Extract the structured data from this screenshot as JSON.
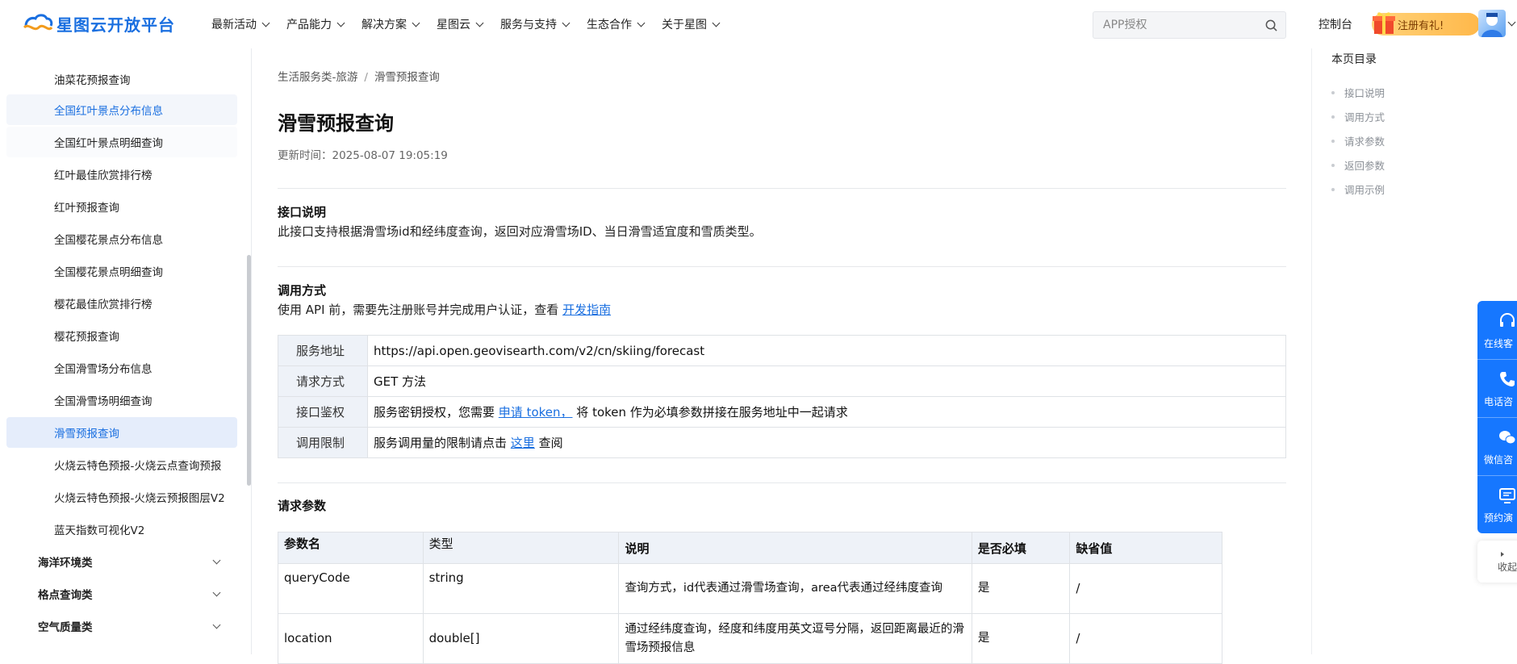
{
  "header": {
    "logo_text": "星图云开放平台",
    "nav": [
      "最新活动",
      "产品能力",
      "解决方案",
      "星图云",
      "服务与支持",
      "生态合作",
      "关于星图"
    ],
    "search_placeholder": "APP授权",
    "console": "控制台",
    "register": "注册有礼!"
  },
  "sidebar": {
    "items": [
      {
        "label": "油菜花预报查询"
      },
      {
        "label": "全国红叶景点分布信息"
      },
      {
        "label": "全国红叶景点明细查询"
      },
      {
        "label": "红叶最佳欣赏排行榜"
      },
      {
        "label": "红叶预报查询"
      },
      {
        "label": "全国樱花景点分布信息"
      },
      {
        "label": "全国樱花景点明细查询"
      },
      {
        "label": "樱花最佳欣赏排行榜"
      },
      {
        "label": "樱花预报查询"
      },
      {
        "label": "全国滑雪场分布信息"
      },
      {
        "label": "全国滑雪场明细查询"
      },
      {
        "label": "滑雪预报查询"
      },
      {
        "label": "火烧云特色预报-火烧云点查询预报"
      },
      {
        "label": "火烧云特色预报-火烧云预报图层V2"
      },
      {
        "label": "蓝天指数可视化V2"
      }
    ],
    "categories": [
      "海洋环境类",
      "格点查询类",
      "空气质量类"
    ]
  },
  "main": {
    "breadcrumb": [
      "生活服务类-旅游",
      "滑雪预报查询"
    ],
    "breadcrumb_sep": "/",
    "title": "滑雪预报查询",
    "update_time": "更新时间：2025-08-07 19:05:19",
    "intro": {
      "title": "接口说明",
      "text": "此接口支持根据滑雪场id和经纬度查询，返回对应滑雪场ID、当日滑雪适宜度和雪质类型。"
    },
    "usage": {
      "title": "调用方式",
      "text_before": "使用 API 前，需要先注册账号并完成用户认证，查看",
      "link": "开发指南"
    },
    "info_table": {
      "service_url_key": "服务地址",
      "service_url": "https://api.open.geovisearth.com/v2/cn/skiing/forecast",
      "method_key": "请求方式",
      "method": "GET 方法",
      "auth_key": "接口鉴权",
      "auth_before": "服务密钥授权，您需要",
      "auth_link": "申请 token，",
      "auth_after": "将 token 作为必填参数拼接在服务地址中一起请求",
      "limit_key": "调用限制",
      "limit_before": "服务调用量的限制请点击",
      "limit_link": "这里",
      "limit_after": "查阅"
    },
    "params": {
      "title": "请求参数",
      "headers": [
        "参数名",
        "类型",
        "说明",
        "是否必填",
        "缺省值"
      ],
      "rows": [
        [
          "queryCode",
          "string",
          "查询方式，id代表通过滑雪场查询，area代表通过经纬度查询",
          "是",
          "/"
        ],
        [
          "location",
          "double[]",
          "通过经纬度查询，经度和纬度用英文逗号分隔，返回距离最近的滑雪场预报信息",
          "是",
          "/"
        ]
      ]
    }
  },
  "toc": {
    "title": "本页目录",
    "items": [
      "接口说明",
      "调用方式",
      "请求参数",
      "返回参数",
      "调用示例"
    ]
  },
  "float": {
    "items": [
      "在线客",
      "电话咨",
      "微信咨",
      "预约演"
    ],
    "collapse": "收起"
  },
  "colors": {
    "accent": "#1a6fe0",
    "float_bg": "#1677ff"
  }
}
